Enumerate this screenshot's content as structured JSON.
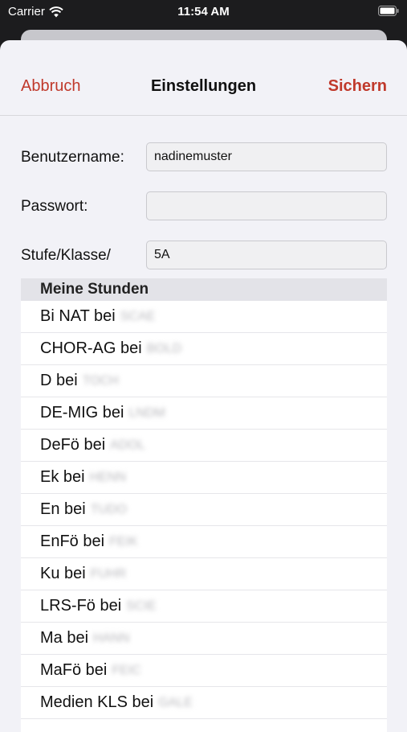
{
  "status_bar": {
    "carrier": "Carrier",
    "time": "11:54 AM"
  },
  "nav": {
    "cancel_label": "Abbruch",
    "title": "Einstellungen",
    "save_label": "Sichern",
    "accent_color": "#c0392b"
  },
  "form": {
    "username_label": "Benutzername:",
    "username_value": "nadinemuster",
    "password_label": "Passwort:",
    "password_value": "",
    "class_label": "Stufe/Klasse/",
    "class_value": "5A"
  },
  "lessons": {
    "header": "Meine Stunden",
    "items": [
      {
        "subject": "Bi NAT bei",
        "teacher": "SCAE"
      },
      {
        "subject": "CHOR-AG bei",
        "teacher": "BOLD"
      },
      {
        "subject": "D bei",
        "teacher": "TOCH"
      },
      {
        "subject": "DE-MIG bei",
        "teacher": "LNDM"
      },
      {
        "subject": "DeFö bei",
        "teacher": "ADOL"
      },
      {
        "subject": "Ek bei",
        "teacher": "HENN"
      },
      {
        "subject": "En bei",
        "teacher": "TUDO"
      },
      {
        "subject": "EnFö bei",
        "teacher": "FEIK"
      },
      {
        "subject": "Ku bei",
        "teacher": "FUHR"
      },
      {
        "subject": "LRS-Fö bei",
        "teacher": "SCIE"
      },
      {
        "subject": "Ma bei",
        "teacher": "HANN"
      },
      {
        "subject": "MaFö bei",
        "teacher": "FEIC"
      },
      {
        "subject": "Medien KLS bei",
        "teacher": "GALE"
      }
    ]
  }
}
